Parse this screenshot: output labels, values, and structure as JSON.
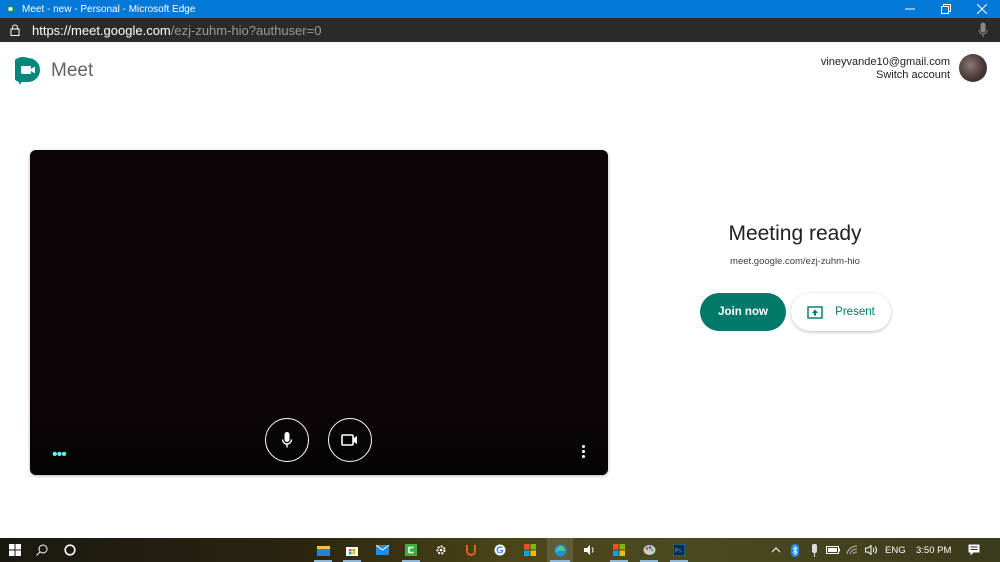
{
  "window": {
    "title": "Meet - new - Personal - Microsoft Edge",
    "controls": [
      "minimize",
      "restore",
      "close"
    ]
  },
  "addressbar": {
    "url_scheme": "https://",
    "url_host": "meet.google.com",
    "url_path": "/ezj-zuhm-hio?authuser=0"
  },
  "header": {
    "logo_text": "Meet",
    "account_email": "vineyvande10@gmail.com",
    "switch_account_label": "Switch account"
  },
  "preview": {
    "controls": [
      "microphone",
      "camera"
    ],
    "more_options_label": "More options"
  },
  "ready": {
    "title": "Meeting ready",
    "meeting_url": "meet.google.com/ezj-zuhm-hio",
    "join_label": "Join now",
    "present_label": "Present"
  },
  "colors": {
    "accent": "#00796b",
    "titlebar": "#0078d7"
  },
  "taskbar": {
    "pinned_apps": [
      "file-explorer",
      "microsoft-store",
      "mail",
      "camtasia",
      "settings",
      "app-u",
      "google-chrome",
      "microsoft-windows",
      "microsoft-edge",
      "volume-app",
      "office",
      "paint",
      "photoshop"
    ],
    "language": "ENG",
    "time": "3:50 PM"
  }
}
